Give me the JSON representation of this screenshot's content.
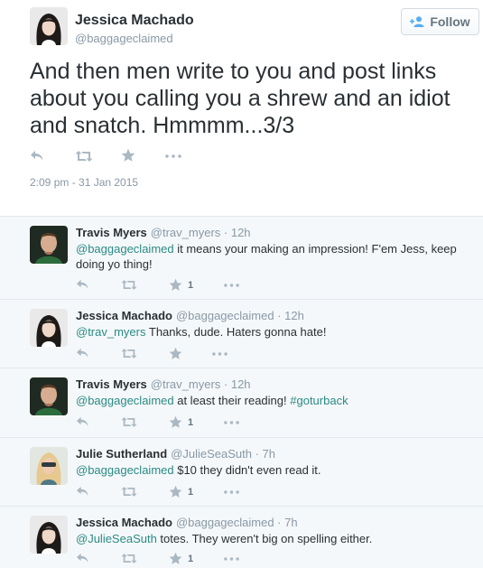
{
  "main": {
    "name": "Jessica Machado",
    "handle": "@baggageclaimed",
    "follow_label": "Follow",
    "text": "And then men write to you and post links about you calling you a shrew and an idiot and snatch. Hmmmm...3/3",
    "timestamp": "2:09 pm - 31 Jan 2015"
  },
  "replies": [
    {
      "name": "Travis Myers",
      "handle": "@trav_myers",
      "time": " · 12h",
      "mention": "@baggageclaimed",
      "text": " it means your making an impression! F'em Jess, keep doing yo thing!",
      "favorites": "1"
    },
    {
      "name": "Jessica Machado",
      "handle": "@baggageclaimed",
      "time": " · 12h",
      "mention": "@trav_myers",
      "text": " Thanks, dude. Haters gonna hate!",
      "favorites": ""
    },
    {
      "name": "Travis Myers",
      "handle": "@trav_myers",
      "time": " · 12h",
      "mention": "@baggageclaimed",
      "text": " at least their reading! ",
      "hashtag": "#goturback",
      "favorites": "1"
    },
    {
      "name": "Julie Sutherland",
      "handle": "@JulieSeaSuth",
      "time": " · 7h",
      "mention": "@baggageclaimed",
      "text": " $10 they didn't even read it.",
      "favorites": "1"
    },
    {
      "name": "Jessica Machado",
      "handle": "@baggageclaimed",
      "time": " · 7h",
      "mention": "@JulieSeaSuth",
      "text": " totes. They weren't big on spelling either.",
      "favorites": "1"
    }
  ],
  "colors": {
    "link": "#2a8a84",
    "icon": "#aab8c2",
    "reply_bg": "#f5f8fa"
  }
}
